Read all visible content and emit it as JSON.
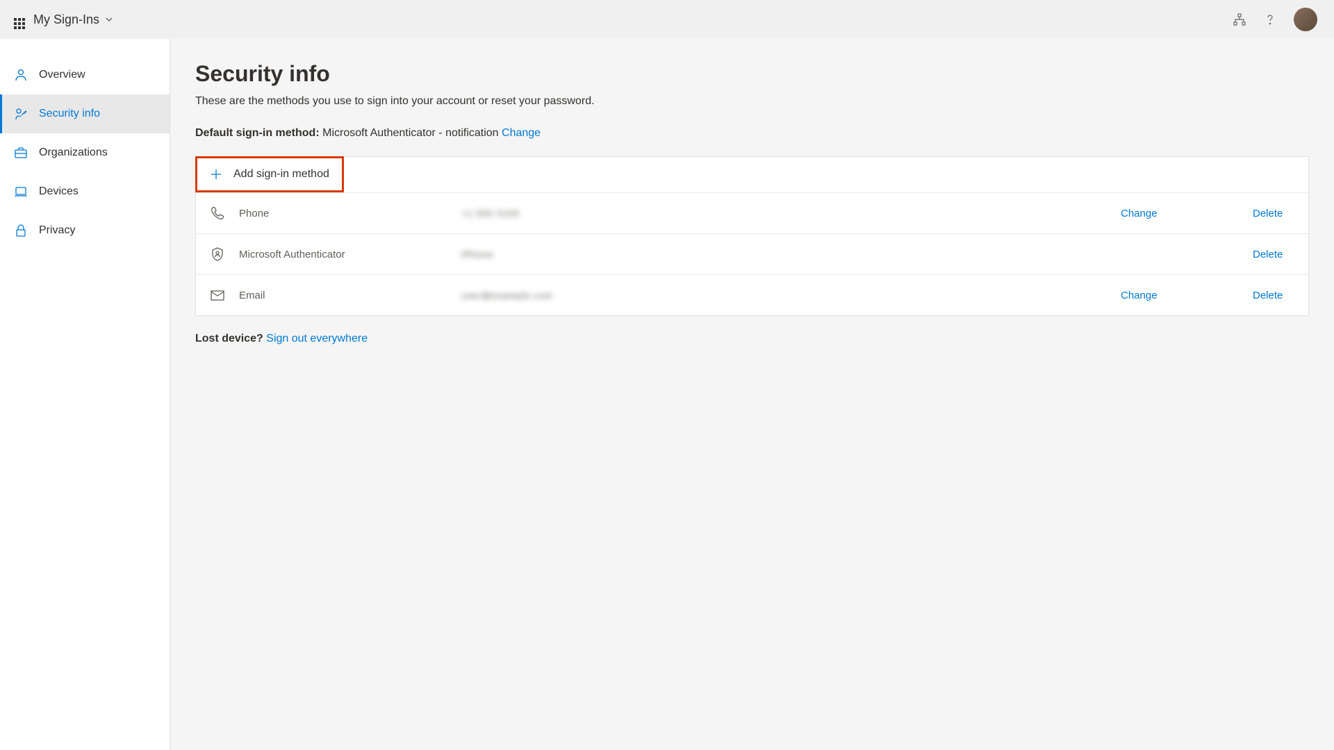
{
  "header": {
    "app_title": "My Sign-Ins"
  },
  "sidebar": {
    "items": [
      {
        "label": "Overview",
        "icon": "person"
      },
      {
        "label": "Security info",
        "icon": "security"
      },
      {
        "label": "Organizations",
        "icon": "briefcase"
      },
      {
        "label": "Devices",
        "icon": "laptop"
      },
      {
        "label": "Privacy",
        "icon": "lock"
      }
    ]
  },
  "main": {
    "title": "Security info",
    "description": "These are the methods you use to sign into your account or reset your password.",
    "default_method_label": "Default sign-in method:",
    "default_method_value": "Microsoft Authenticator - notification",
    "change_label": "Change",
    "add_method_label": "Add sign-in method",
    "methods": [
      {
        "name": "Phone",
        "value": "+1 555 0100",
        "change": "Change",
        "delete": "Delete"
      },
      {
        "name": "Microsoft Authenticator",
        "value": "iPhone",
        "change": "",
        "delete": "Delete"
      },
      {
        "name": "Email",
        "value": "user@example.com",
        "change": "Change",
        "delete": "Delete"
      }
    ],
    "lost_device_label": "Lost device?",
    "sign_out_label": "Sign out everywhere"
  }
}
